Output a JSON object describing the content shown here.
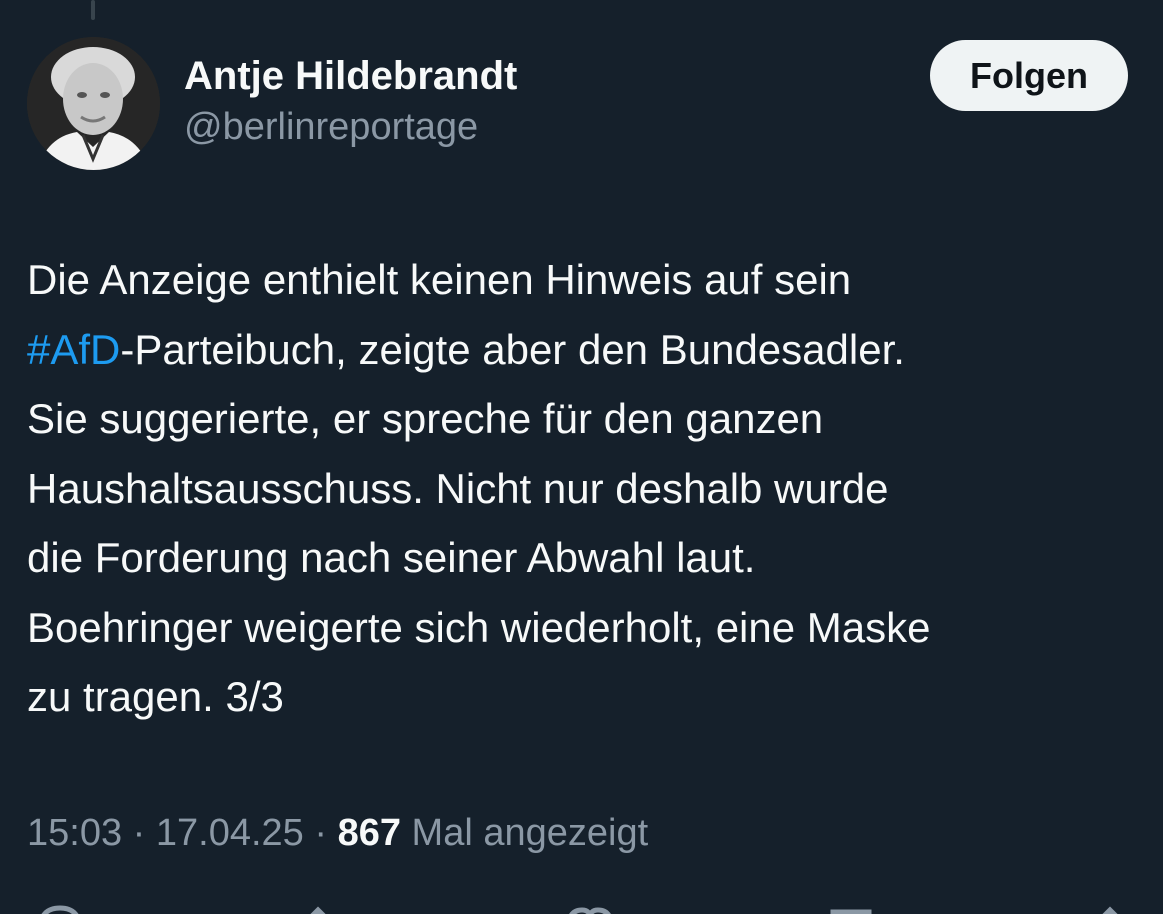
{
  "author": {
    "display_name": "Antje Hildebrandt",
    "handle": "@berlinreportage",
    "avatar_icon": "profile-photo"
  },
  "follow_button": {
    "label": "Folgen"
  },
  "tweet": {
    "line1": "Die Anzeige enthielt keinen Hinweis auf sein",
    "hashtag": "#AfD",
    "line2_rest": "-Parteibuch, zeigte aber den Bundesadler.",
    "line3": "Sie suggerierte, er spreche für den ganzen",
    "line4": "Haushaltsausschuss. Nicht nur deshalb wurde",
    "line5": "die Forderung nach seiner Abwahl laut.",
    "line6": "Boehringer weigerte sich wiederholt, eine Maske",
    "line7": "zu tragen. 3/3"
  },
  "meta": {
    "time": "15:03",
    "separator": "·",
    "date": "17.04.25",
    "views_count": "867",
    "views_label": "Mal angezeigt"
  },
  "actions": {
    "icons": [
      "reply-icon",
      "retweet-icon",
      "like-icon",
      "bookmark-icon",
      "share-icon"
    ]
  },
  "colors": {
    "background": "#15202b",
    "text": "#f7f9f9",
    "muted": "#8b98a5",
    "accent": "#1d9bf0",
    "button_bg": "#eff3f4"
  }
}
